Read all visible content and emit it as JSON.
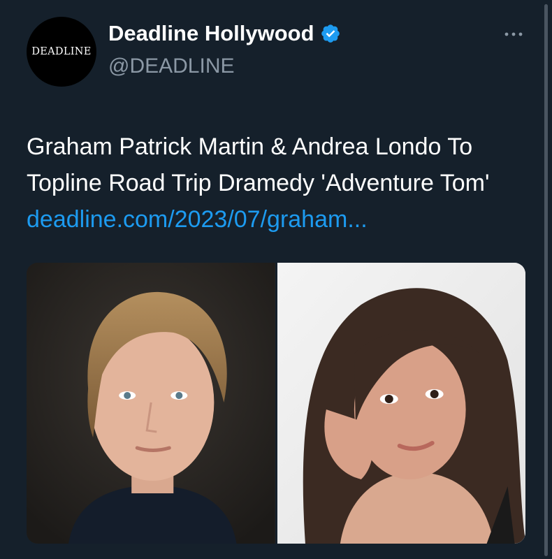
{
  "account": {
    "display_name": "Deadline Hollywood",
    "handle": "@DEADLINE",
    "avatar_text": "DEADLINE",
    "verified": true
  },
  "tweet": {
    "text": "Graham Patrick Martin & Andrea Londo To Topline Road Trip Dramedy 'Adventure Tom' ",
    "link_text": "deadline.com/2023/07/graham..."
  },
  "media": {
    "photo_count": 2
  },
  "icons": {
    "verified": "verified-badge-icon",
    "more": "more-options-icon"
  },
  "colors": {
    "background": "#15202b",
    "link": "#1d9bf0",
    "verified": "#1d9bf0",
    "secondary_text": "#8b98a5"
  }
}
